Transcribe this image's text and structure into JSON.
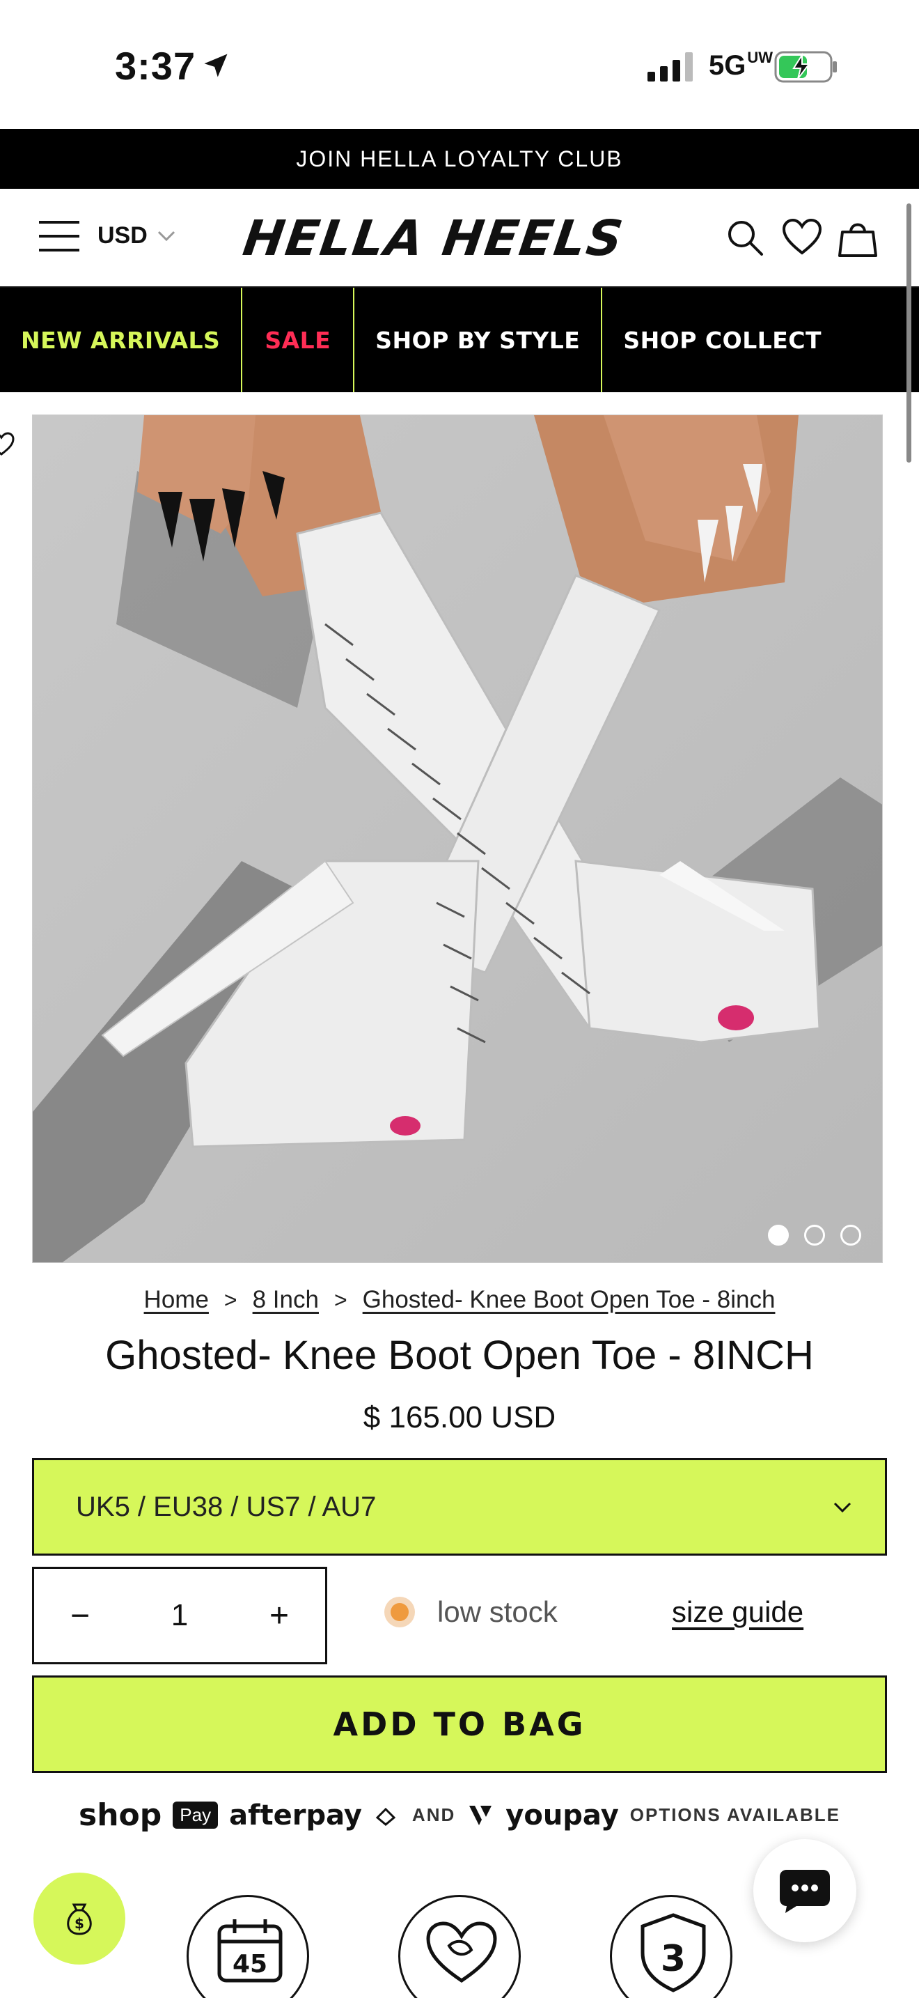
{
  "status_bar": {
    "time": "3:37",
    "network": "5G",
    "network_sup": "UW"
  },
  "loyalty_banner": {
    "text": "JOIN HELLA LOYALTY CLUB"
  },
  "header": {
    "currency": "USD",
    "logo": "HELLA HEELS"
  },
  "nav": {
    "items": [
      {
        "label": "NEW ARRIVALS",
        "color": "#d6f75a"
      },
      {
        "label": "SALE",
        "color": "#ff2d55"
      },
      {
        "label": "SHOP BY STYLE",
        "color": "#ffffff"
      },
      {
        "label": "SHOP COLLECT",
        "color": "#ffffff"
      }
    ]
  },
  "product": {
    "image_dots": 3,
    "active_dot": 1,
    "breadcrumb": [
      "Home",
      "8 Inch",
      "Ghosted- Knee Boot Open Toe - 8inch"
    ],
    "title": "Ghosted- Knee Boot Open Toe - 8INCH",
    "price": "$ 165.00 USD",
    "variant": "UK5 / EU38 / US7 / AU7",
    "quantity": "1",
    "stock_status": "low stock",
    "size_guide": "size guide",
    "add_to_bag": "ADD TO BAG"
  },
  "payments": {
    "shop": "shop",
    "pay": "Pay",
    "afterpay": "afterpay",
    "and": "AND",
    "youpay": "youpay",
    "suffix": "OPTIONS AVAILABLE"
  },
  "badges": {
    "days": "45",
    "years": "3"
  },
  "colors": {
    "accent": "#d6f75a",
    "sale": "#ff2d55",
    "black": "#000000",
    "low_stock": "#ef9a3e"
  }
}
